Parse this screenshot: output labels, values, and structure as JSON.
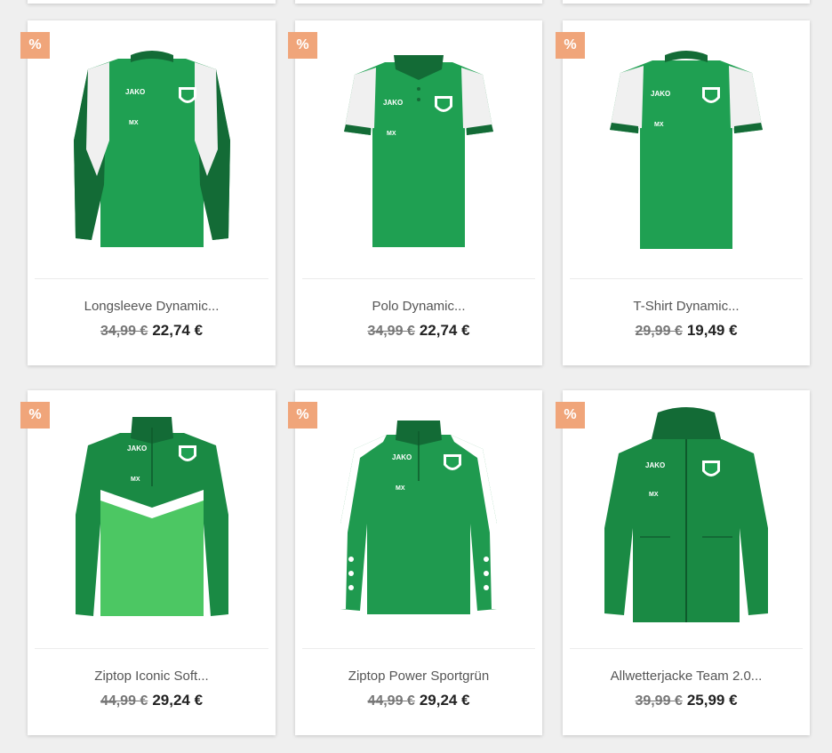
{
  "colors": {
    "badge": "#f0a57a",
    "green": "#1f9a4f",
    "dark_green": "#136b36",
    "light_green": "#4cc763"
  },
  "products": [
    {
      "badge": "%",
      "title": "Longsleeve Dynamic...",
      "old_price": "34,99 €",
      "price": "22,74 €",
      "icon": "longsleeve-shirt-icon",
      "brand": "JAKO",
      "initials": "MX"
    },
    {
      "badge": "%",
      "title": "Polo Dynamic...",
      "old_price": "34,99 €",
      "price": "22,74 €",
      "icon": "polo-shirt-icon",
      "brand": "JAKO",
      "initials": "MX"
    },
    {
      "badge": "%",
      "title": "T-Shirt Dynamic...",
      "old_price": "29,99 €",
      "price": "19,49 €",
      "icon": "tshirt-icon",
      "brand": "JAKO",
      "initials": "MX"
    },
    {
      "badge": "%",
      "title": "Ziptop Iconic Soft...",
      "old_price": "44,99 €",
      "price": "29,24 €",
      "icon": "ziptop-iconic-icon",
      "brand": "JAKO",
      "initials": "MX"
    },
    {
      "badge": "%",
      "title": "Ziptop Power Sportgrün",
      "old_price": "44,99 €",
      "price": "29,24 €",
      "icon": "ziptop-power-icon",
      "brand": "JAKO",
      "initials": "MX"
    },
    {
      "badge": "%",
      "title": "Allwetterjacke Team 2.0...",
      "old_price": "39,99 €",
      "price": "25,99 €",
      "icon": "rain-jacket-icon",
      "brand": "JAKO",
      "initials": "MX"
    }
  ]
}
